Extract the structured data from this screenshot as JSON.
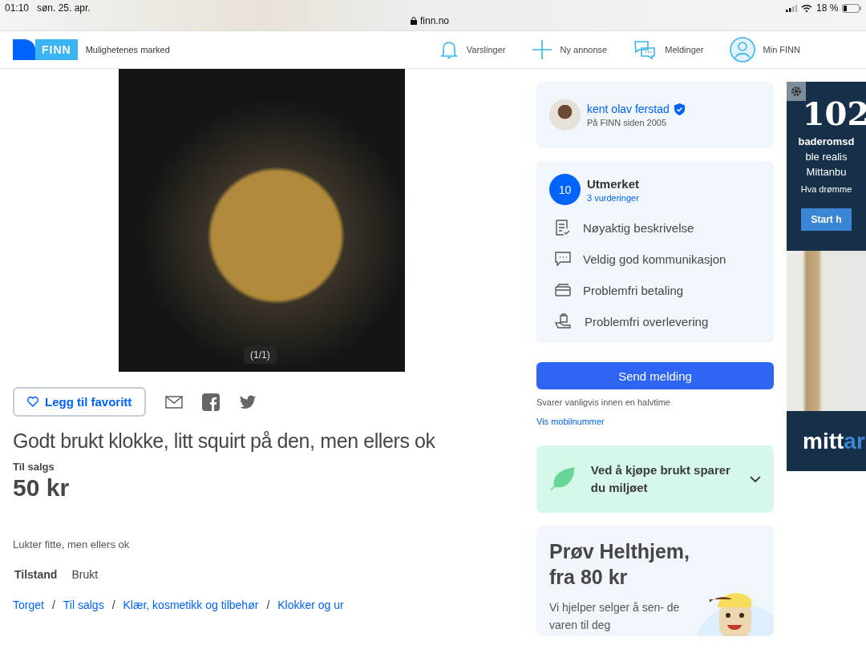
{
  "status_bar": {
    "time": "01:10",
    "date": "søn. 25. apr.",
    "url": "finn.no",
    "battery": "18 %"
  },
  "header": {
    "logo": "FINN",
    "tagline": "Mulighetenes marked",
    "nav": [
      {
        "label": "Varslinger"
      },
      {
        "label": "Ny annonse"
      },
      {
        "label": "Meldinger"
      },
      {
        "label": "Min FINN"
      }
    ]
  },
  "listing": {
    "photo_counter": "(1/1)",
    "favorite": "Legg til favoritt",
    "title": "Godt brukt klokke, litt squirt på den, men ellers ok",
    "type": "Til salgs",
    "price": "50 kr",
    "description": "Lukter fitte, men ellers ok",
    "attributes": [
      {
        "label": "Tilstand",
        "value": "Brukt"
      }
    ],
    "breadcrumbs": [
      {
        "label": "Torget"
      },
      {
        "separator": "/",
        "label": "Til salgs"
      },
      {
        "separator": "/",
        "label": "Klær, kosmetikk og tilbehør"
      },
      {
        "separator": "/",
        "label": "Klokker og ur"
      }
    ]
  },
  "seller": {
    "name": "kent olav ferstad",
    "verified": true,
    "since": "På FINN siden 2005"
  },
  "rating": {
    "score": "10",
    "label": "Utmerket",
    "count": "3 vurderinger",
    "badges": [
      "Nøyaktig beskrivelse",
      "Veldig god kommunikasjon",
      "Problemfri betaling",
      "Problemfri overlevering"
    ]
  },
  "contact": {
    "button": "Send melding",
    "response": "Svarer vanligvis innen en halvtime",
    "phone_link": "Vis mobilnummer"
  },
  "eco": {
    "text": "Ved å kjøpe brukt sparer du miljøet",
    "expanded": false
  },
  "promo": {
    "title": "Prøv Helthjem, fra 80 kr",
    "text": "Vi hjelper selger å sen- de varen til deg"
  },
  "ad": {
    "number": "102",
    "line1": "baderomsd",
    "line2": "ble realis",
    "line3": "Mittanbu",
    "line4": "Hva drømme",
    "button": "Start h",
    "logo_main": "mitt",
    "logo_accent": "ar"
  }
}
